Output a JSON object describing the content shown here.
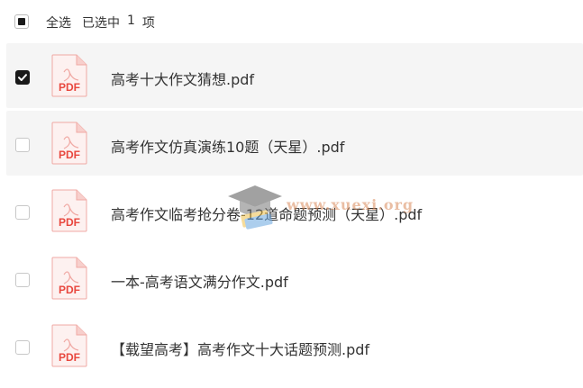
{
  "header": {
    "select_all": "全选",
    "selected_prefix": "已选中",
    "selected_count": "1",
    "selected_suffix": "项"
  },
  "file_icon_label": "PDF",
  "files": [
    {
      "name": "高考十大作文猜想.pdf",
      "checked": true
    },
    {
      "name": "高考作文仿真演练10题（天星）.pdf",
      "checked": false
    },
    {
      "name": "高考作文临考抢分卷-12道命题预测（天星）.pdf",
      "checked": false
    },
    {
      "name": "一本-高考语文满分作文.pdf",
      "checked": false
    },
    {
      "name": "【载望高考】高考作文十大话题预测.pdf",
      "checked": false
    }
  ],
  "watermark": {
    "text": "www.xuexi.org"
  },
  "colors": {
    "pdf_red": "#e8473e",
    "check_bg": "#1a1a1a",
    "row_bg": "#f5f5f5"
  }
}
